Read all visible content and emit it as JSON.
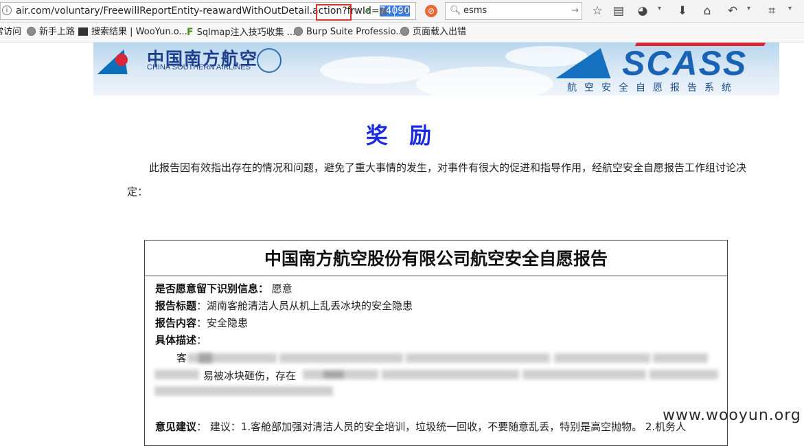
{
  "browser": {
    "url_prefix": "air.com/voluntary/FreewillReportEntity-reawardWithOutDetail.action?frwId=",
    "url_selected": "74090",
    "search_text": "esms",
    "info_icon": "i"
  },
  "bookmarks": [
    {
      "label": "常访问"
    },
    {
      "label": "新手上路"
    },
    {
      "label": "搜索结果 | WooYun.o..."
    },
    {
      "label": "Sqlmap注入技巧收集 ..."
    },
    {
      "label": "Burp Suite Professio..."
    },
    {
      "label": "页面载入出错"
    }
  ],
  "banner": {
    "airline_cn": "中国南方航空",
    "airline_en": "CHINA SOUTHERN AIRLINES",
    "system_logo": "SCASS",
    "system_name": "航空安全自愿报告系统"
  },
  "page": {
    "title": "奖 励",
    "intro": "此报告因有效指出存在的情况和问题，避免了重大事情的发生，对事件有很大的促进和指导作用，经航空安全自愿报告工作组讨论决定："
  },
  "report": {
    "title": "中国南方航空股份有限公司航空安全自愿报告",
    "identity_label": "是否愿意留下识别信息：",
    "identity_value": "愿意",
    "subject_label": "报告标题",
    "subject_value": "：湖南客舱清洁人员从机上乱丢冰块的安全隐患",
    "content_label": "报告内容",
    "content_value": "：安全隐患",
    "desc_label": "具体描述",
    "desc_colon": "：",
    "desc_visible_1": "客",
    "desc_visible_2": "易被冰块砸伤，存在",
    "suggest_label": "意见建议",
    "suggest_value": "：  建议：1.客舱部加强对清洁人员的安全培训，垃圾统一回收，不要随意乱丢，特别是高空抛物。 2.机务人"
  },
  "watermark": "www.wooyun.org",
  "colors": {
    "title_blue": "#1a2be0",
    "selection_blue": "#3a7be0",
    "highlight_red": "#e0302a"
  },
  "icons": [
    "info-icon",
    "shield-icon",
    "qr-icon",
    "reload-icon",
    "stop-icon",
    "search-icon",
    "star-icon",
    "reader-icon",
    "palette-icon",
    "download-icon",
    "home-icon",
    "back-icon",
    "crop-icon",
    "globe-icon"
  ]
}
